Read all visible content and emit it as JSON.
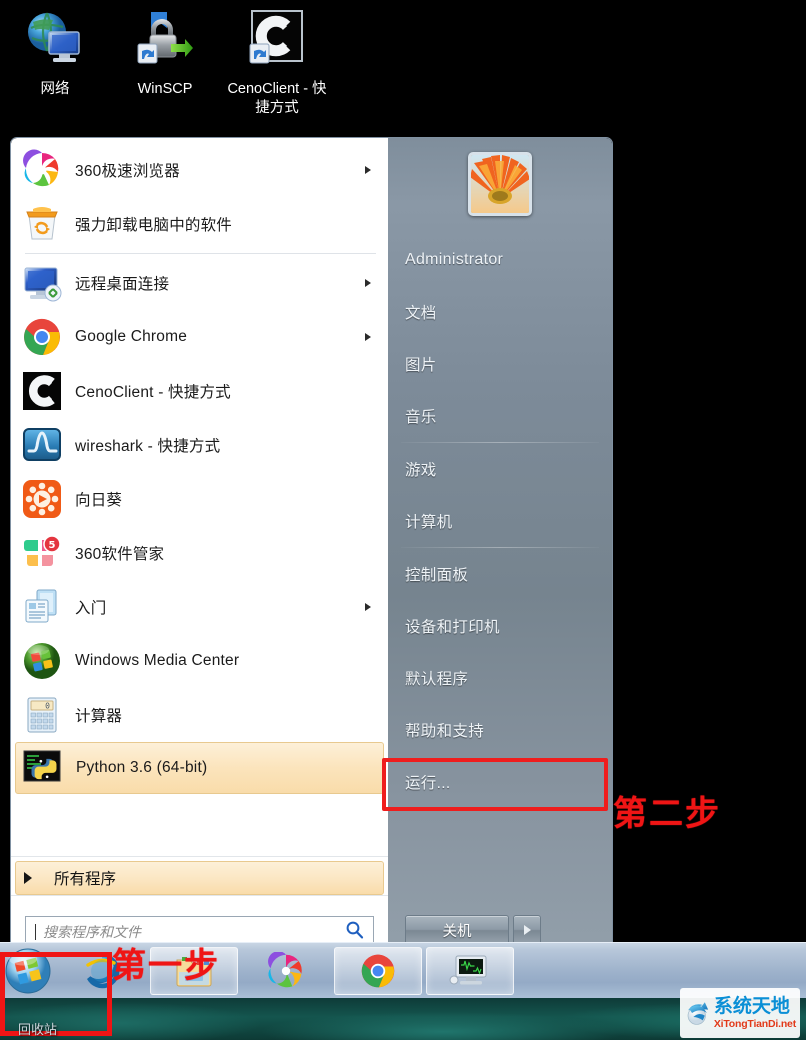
{
  "desktop": {
    "icons": [
      {
        "name": "网络",
        "icon": "network-icon"
      },
      {
        "name": "WinSCP",
        "icon": "winscp-icon"
      },
      {
        "name": "CenoClient - 快捷方式",
        "icon": "cenoclient-icon"
      }
    ],
    "bottom_caption": "回收站"
  },
  "start_menu": {
    "programs": [
      {
        "label": "360极速浏览器",
        "icon": "360-browser-icon",
        "has_submenu": true,
        "selected": false
      },
      {
        "label": "强力卸载电脑中的软件",
        "icon": "uninstall-icon",
        "has_submenu": false,
        "selected": false
      },
      {
        "label": "远程桌面连接",
        "icon": "remote-desktop-icon",
        "has_submenu": true,
        "selected": false
      },
      {
        "label": "Google Chrome",
        "icon": "chrome-icon",
        "has_submenu": true,
        "selected": false
      },
      {
        "label": "CenoClient - 快捷方式",
        "icon": "cenoclient-icon",
        "has_submenu": false,
        "selected": false
      },
      {
        "label": "wireshark - 快捷方式",
        "icon": "wireshark-icon",
        "has_submenu": false,
        "selected": false
      },
      {
        "label": "向日葵",
        "icon": "sunflower-icon",
        "has_submenu": false,
        "selected": false
      },
      {
        "label": "360软件管家",
        "icon": "360-software-manager-icon",
        "has_submenu": false,
        "selected": false
      },
      {
        "label": "入门",
        "icon": "getting-started-icon",
        "has_submenu": true,
        "selected": false
      },
      {
        "label": "Windows Media Center",
        "icon": "media-center-icon",
        "has_submenu": false,
        "selected": false
      },
      {
        "label": "计算器",
        "icon": "calculator-icon",
        "has_submenu": false,
        "selected": false
      },
      {
        "label": "Python 3.6 (64-bit)",
        "icon": "python-icon",
        "has_submenu": false,
        "selected": true
      }
    ],
    "all_programs_label": "所有程序",
    "search": {
      "placeholder": "搜索程序和文件",
      "value": "",
      "icon": "search-icon"
    },
    "right_panel": {
      "user_name": "Administrator",
      "avatar_icon": "sunflower-avatar",
      "items": [
        {
          "label": "文档",
          "highlighted": false
        },
        {
          "label": "图片",
          "highlighted": false
        },
        {
          "label": "音乐",
          "highlighted": false
        },
        {
          "label": "游戏",
          "highlighted": false
        },
        {
          "label": "计算机",
          "highlighted": false
        },
        {
          "label": "控制面板",
          "highlighted": false
        },
        {
          "label": "设备和打印机",
          "highlighted": false
        },
        {
          "label": "默认程序",
          "highlighted": false
        },
        {
          "label": "帮助和支持",
          "highlighted": false
        },
        {
          "label": "运行...",
          "highlighted": true
        }
      ],
      "shutdown_label": "关机",
      "shutdown_more_icon": "chevron-right-icon"
    }
  },
  "taskbar": {
    "start_orb_icon": "windows-start-orb",
    "buttons": [
      {
        "icon": "internet-explorer-icon",
        "framed": false
      },
      {
        "icon": "windows-explorer-icon",
        "framed": true
      },
      {
        "icon": "360-browser-icon",
        "framed": false
      },
      {
        "icon": "chrome-icon",
        "framed": true
      },
      {
        "icon": "remote-monitor-icon",
        "framed": true
      }
    ]
  },
  "annotations": [
    {
      "id": "step1",
      "text": "第一步",
      "color": "#ef1515"
    },
    {
      "id": "step2",
      "text": "第二步",
      "color": "#ef1515"
    }
  ],
  "watermark": {
    "main": "系统天地",
    "sub": "XiTongTianDi.net",
    "icon": "recycle-arrow-logo",
    "main_color": "#0a8fd6",
    "sub_color": "#e23a1a"
  }
}
